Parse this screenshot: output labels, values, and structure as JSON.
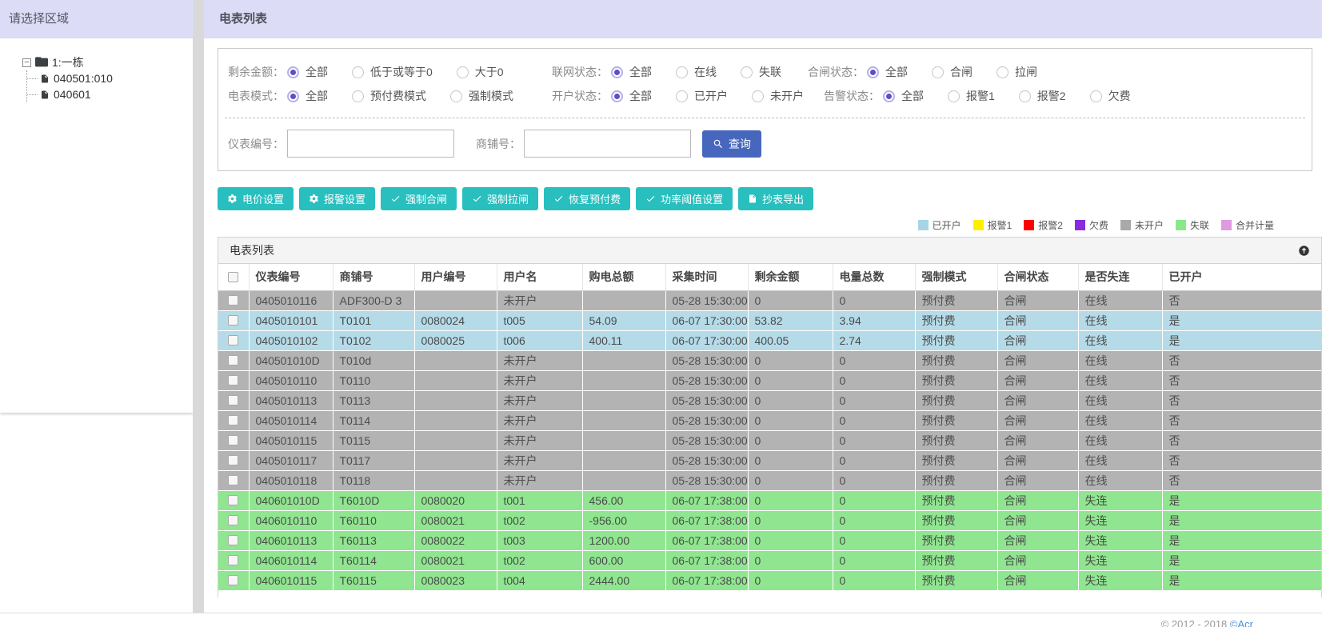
{
  "sidebar": {
    "title": "请选择区域",
    "tree": {
      "root_label": "1:一栋",
      "children": [
        "040501:010",
        "040601"
      ]
    }
  },
  "main_header": {
    "title": "电表列表"
  },
  "filters": {
    "rows": [
      [
        {
          "label": "剩余金额：",
          "options": [
            "全部",
            "低于或等于0",
            "大于0"
          ],
          "selected": 0
        },
        {
          "label": "联网状态：",
          "options": [
            "全部",
            "在线",
            "失联"
          ],
          "selected": 0
        },
        {
          "label": "合闸状态：",
          "options": [
            "全部",
            "合闸",
            "拉闸"
          ],
          "selected": 0
        }
      ],
      [
        {
          "label": "电表模式：",
          "options": [
            "全部",
            "预付费模式",
            "强制模式"
          ],
          "selected": 0
        },
        {
          "label": "开户状态：",
          "options": [
            "全部",
            "已开户",
            "未开户"
          ],
          "selected": 0
        },
        {
          "label": "告警状态：",
          "options": [
            "全部",
            "报警1",
            "报警2",
            "欠费"
          ],
          "selected": 0
        }
      ]
    ],
    "meter_no": {
      "label": "仪表编号：",
      "value": ""
    },
    "shop_no": {
      "label": "商铺号：",
      "value": ""
    },
    "search_button_label": "查询"
  },
  "action_buttons": [
    {
      "icon": "gear-icon",
      "label": "电价设置"
    },
    {
      "icon": "gear-icon",
      "label": "报警设置"
    },
    {
      "icon": "check-icon",
      "label": "强制合闸"
    },
    {
      "icon": "check-icon",
      "label": "强制拉闸"
    },
    {
      "icon": "check-icon",
      "label": "恢复预付费"
    },
    {
      "icon": "check-icon",
      "label": "功率阈值设置"
    },
    {
      "icon": "file-icon",
      "label": "抄表导出"
    }
  ],
  "legend": {
    "items": [
      {
        "label": "已开户",
        "color": "#a7d5e5"
      },
      {
        "label": "报警1",
        "color": "#ffee00"
      },
      {
        "label": "报警2",
        "color": "#ff0000"
      },
      {
        "label": "欠费",
        "color": "#8a2be2"
      },
      {
        "label": "未开户",
        "color": "#a9a9a9"
      },
      {
        "label": "失联",
        "color": "#8ae88a"
      },
      {
        "label": "合并计量",
        "color": "#e09ae0"
      }
    ]
  },
  "table": {
    "panel_title": "电表列表",
    "columns": [
      "仪表编号",
      "商铺号",
      "用户编号",
      "用户名",
      "购电总额",
      "采集时间",
      "剩余金额",
      "电量总数",
      "强制模式",
      "合闸状态",
      "是否失连",
      "已开户"
    ],
    "rows": [
      {
        "color": "gray",
        "highlight_from": null,
        "cells": [
          "0405010116",
          "ADF300-D 3",
          "",
          "未开户",
          "",
          "05-28 15:30:00",
          "0",
          "0",
          "预付费",
          "合闸",
          "在线",
          "否"
        ]
      },
      {
        "color": "blue",
        "highlight_from": 4,
        "cells": [
          "0405010101",
          "T0101",
          "0080024",
          "t005",
          "54.09",
          "06-07 17:30:00",
          "53.82",
          "3.94",
          "预付费",
          "合闸",
          "在线",
          "是"
        ]
      },
      {
        "color": "blue",
        "highlight_from": null,
        "cells": [
          "0405010102",
          "T0102",
          "0080025",
          "t006",
          "400.11",
          "06-07 17:30:00",
          "400.05",
          "2.74",
          "预付费",
          "合闸",
          "在线",
          "是"
        ]
      },
      {
        "color": "gray",
        "highlight_from": null,
        "cells": [
          "040501010D",
          "T010d",
          "",
          "未开户",
          "",
          "05-28 15:30:00",
          "0",
          "0",
          "预付费",
          "合闸",
          "在线",
          "否"
        ]
      },
      {
        "color": "gray",
        "highlight_from": null,
        "cells": [
          "0405010110",
          "T0110",
          "",
          "未开户",
          "",
          "05-28 15:30:00",
          "0",
          "0",
          "预付费",
          "合闸",
          "在线",
          "否"
        ]
      },
      {
        "color": "gray",
        "highlight_from": null,
        "cells": [
          "0405010113",
          "T0113",
          "",
          "未开户",
          "",
          "05-28 15:30:00",
          "0",
          "0",
          "预付费",
          "合闸",
          "在线",
          "否"
        ]
      },
      {
        "color": "gray",
        "highlight_from": null,
        "cells": [
          "0405010114",
          "T0114",
          "",
          "未开户",
          "",
          "05-28 15:30:00",
          "0",
          "0",
          "预付费",
          "合闸",
          "在线",
          "否"
        ]
      },
      {
        "color": "gray",
        "highlight_from": null,
        "cells": [
          "0405010115",
          "T0115",
          "",
          "未开户",
          "",
          "05-28 15:30:00",
          "0",
          "0",
          "预付费",
          "合闸",
          "在线",
          "否"
        ]
      },
      {
        "color": "gray",
        "highlight_from": null,
        "cells": [
          "0405010117",
          "T0117",
          "",
          "未开户",
          "",
          "05-28 15:30:00",
          "0",
          "0",
          "预付费",
          "合闸",
          "在线",
          "否"
        ]
      },
      {
        "color": "gray",
        "highlight_from": null,
        "cells": [
          "0405010118",
          "T0118",
          "",
          "未开户",
          "",
          "05-28 15:30:00",
          "0",
          "0",
          "预付费",
          "合闸",
          "在线",
          "否"
        ]
      },
      {
        "color": "green",
        "highlight_from": null,
        "cells": [
          "040601010D",
          "T6010D",
          "0080020",
          "t001",
          "456.00",
          "06-07 17:38:00",
          "0",
          "0",
          "预付费",
          "合闸",
          "失连",
          "是"
        ]
      },
      {
        "color": "green",
        "highlight_from": null,
        "cells": [
          "0406010110",
          "T60110",
          "0080021",
          "t002",
          "-956.00",
          "06-07 17:38:00",
          "0",
          "0",
          "预付费",
          "合闸",
          "失连",
          "是"
        ]
      },
      {
        "color": "green",
        "highlight_from": null,
        "cells": [
          "0406010113",
          "T60113",
          "0080022",
          "t003",
          "1200.00",
          "06-07 17:38:00",
          "0",
          "0",
          "预付费",
          "合闸",
          "失连",
          "是"
        ]
      },
      {
        "color": "green",
        "highlight_from": null,
        "cells": [
          "0406010114",
          "T60114",
          "0080021",
          "t002",
          "600.00",
          "06-07 17:38:00",
          "0",
          "0",
          "预付费",
          "合闸",
          "失连",
          "是"
        ]
      },
      {
        "color": "green",
        "highlight_from": null,
        "cells": [
          "0406010115",
          "T60115",
          "0080023",
          "t004",
          "2444.00",
          "06-07 17:38:00",
          "0",
          "0",
          "预付费",
          "合闸",
          "失连",
          "是"
        ]
      }
    ]
  },
  "footer": {
    "text": "© 2012 - 2018 ",
    "link": "©Acr"
  },
  "colors": {
    "header_lavender": "#dcdcf7",
    "accent_teal": "#29bfbf",
    "accent_blue": "#4667bd",
    "row_gray": "#b3b3b3",
    "row_blue": "#b5dbe8",
    "row_green": "#90e690",
    "cell_alarm_yellow": "#ffd400"
  }
}
